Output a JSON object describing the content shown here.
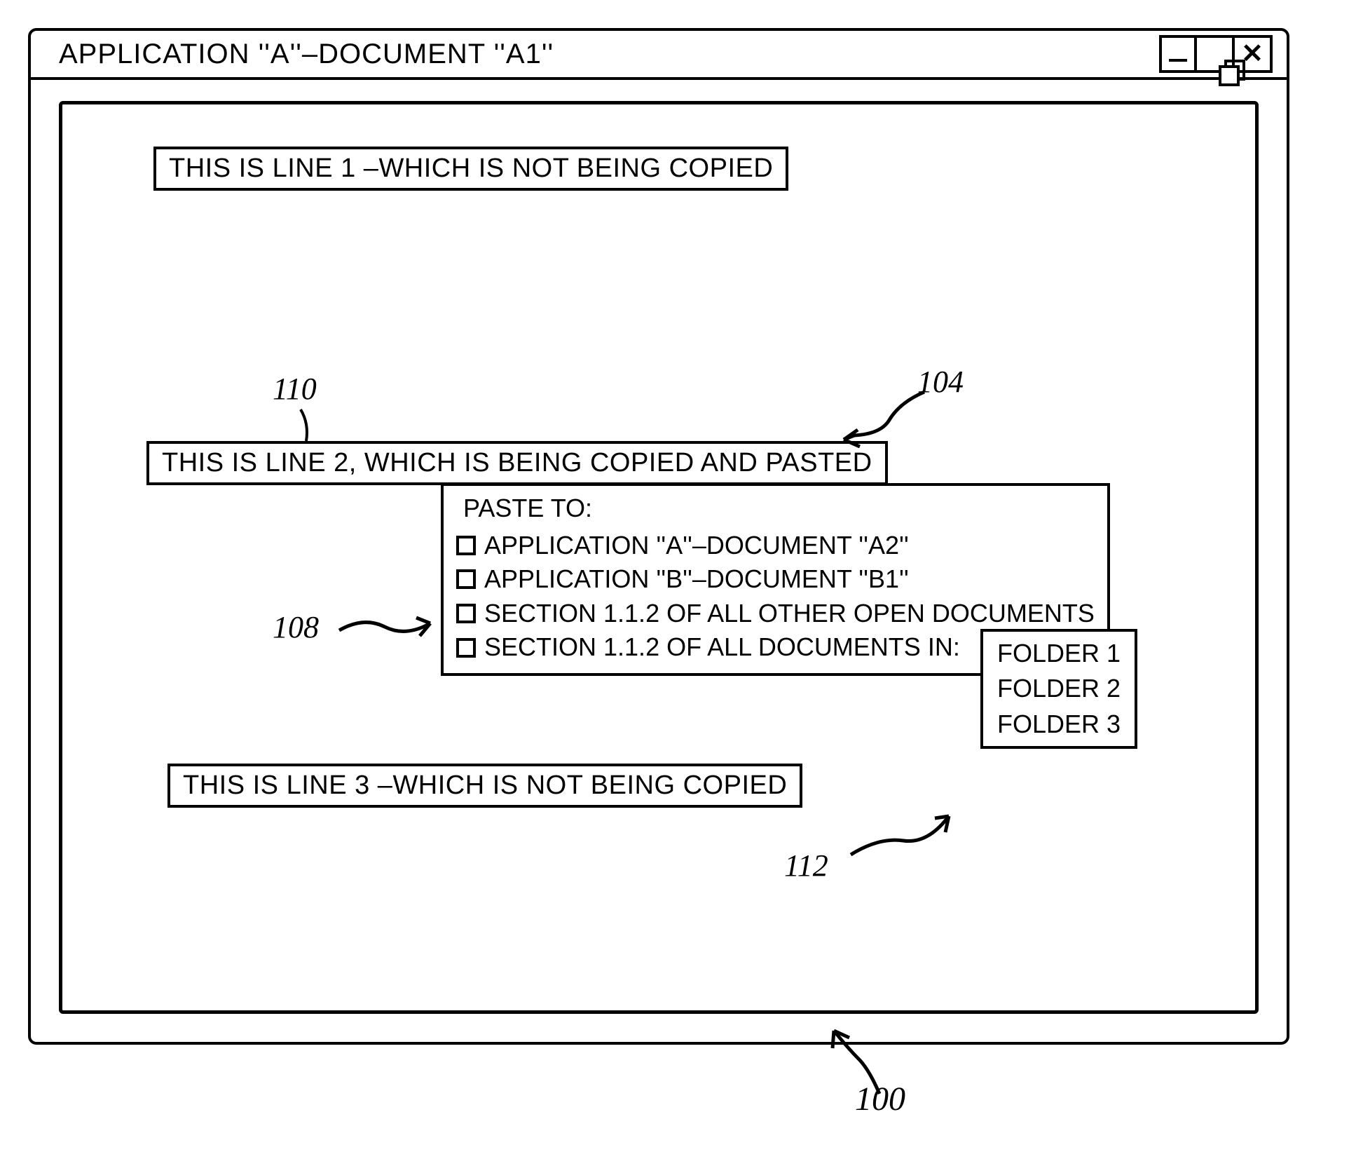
{
  "window": {
    "title": "APPLICATION ''A''–DOCUMENT ''A1''"
  },
  "lines": {
    "line1": "THIS IS LINE 1 –WHICH IS NOT BEING COPIED",
    "line2": "THIS IS LINE 2, WHICH IS BEING COPIED AND PASTED",
    "line3": "THIS IS LINE 3 –WHICH IS NOT BEING COPIED"
  },
  "paste_menu": {
    "title": "PASTE TO:",
    "items": [
      "APPLICATION ''A''–DOCUMENT ''A2''",
      "APPLICATION ''B''–DOCUMENT ''B1''",
      "SECTION 1.1.2 OF ALL OTHER OPEN DOCUMENTS",
      "SECTION 1.1.2 OF ALL DOCUMENTS IN:"
    ]
  },
  "folder_submenu": {
    "items": [
      "FOLDER 1",
      "FOLDER 2",
      "FOLDER 3"
    ]
  },
  "callouts": {
    "c100": "100",
    "c104": "104",
    "c108": "108",
    "c110": "110",
    "c112": "112"
  }
}
